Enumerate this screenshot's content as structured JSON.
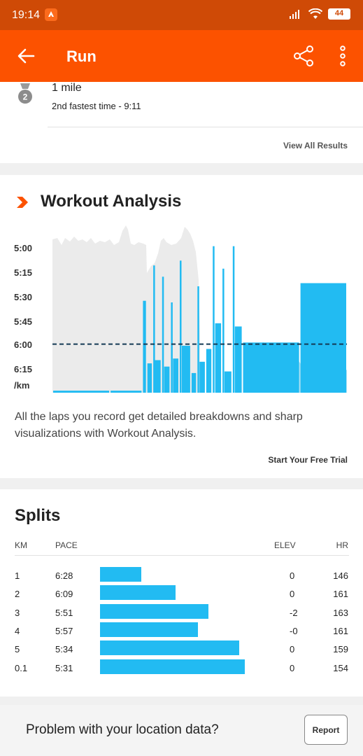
{
  "status_bar": {
    "time": "19:14",
    "battery": "44"
  },
  "app_bar": {
    "title": "Run",
    "back_icon": "back-arrow-icon",
    "share_icon": "share-icon",
    "more_icon": "more-vertical-icon"
  },
  "achievement": {
    "title": "1 mile",
    "subtitle": "2nd fastest time - 9:11",
    "medal_rank": "2",
    "view_all_label": "View All Results"
  },
  "workout_analysis": {
    "title": "Workout Analysis",
    "description": "All the laps you record get detailed breakdowns and sharp visualizations with Workout Analysis.",
    "trial_label": "Start Your Free Trial",
    "accent": "#fc5200",
    "bar_color": "#22bbf2",
    "y_tick_labels": [
      "5:00",
      "5:15",
      "5:30",
      "5:45",
      "6:00",
      "6:15",
      "/km"
    ]
  },
  "chart_data": {
    "type": "bar",
    "title": "",
    "ylabel": "/km",
    "y_ticks": [
      "5:00",
      "5:15",
      "5:30",
      "5:45",
      "6:00",
      "6:15"
    ],
    "average_pace_line": "6:00",
    "laps": [
      {
        "start": 0.0,
        "end": 0.195,
        "pace_sec": 389
      },
      {
        "start": 0.195,
        "end": 0.305,
        "pace_sec": 389
      },
      {
        "start": 0.305,
        "end": 0.32,
        "pace_sec": 333
      },
      {
        "start": 0.32,
        "end": 0.34,
        "pace_sec": 372
      },
      {
        "start": 0.34,
        "end": 0.345,
        "pace_sec": 311
      },
      {
        "start": 0.345,
        "end": 0.37,
        "pace_sec": 370
      },
      {
        "start": 0.37,
        "end": 0.377,
        "pace_sec": 318
      },
      {
        "start": 0.377,
        "end": 0.4,
        "pace_sec": 374
      },
      {
        "start": 0.4,
        "end": 0.407,
        "pace_sec": 334
      },
      {
        "start": 0.407,
        "end": 0.43,
        "pace_sec": 369
      },
      {
        "start": 0.43,
        "end": 0.437,
        "pace_sec": 308
      },
      {
        "start": 0.437,
        "end": 0.47,
        "pace_sec": 361
      },
      {
        "start": 0.47,
        "end": 0.49,
        "pace_sec": 378
      },
      {
        "start": 0.49,
        "end": 0.497,
        "pace_sec": 324
      },
      {
        "start": 0.497,
        "end": 0.52,
        "pace_sec": 371
      },
      {
        "start": 0.52,
        "end": 0.542,
        "pace_sec": 363
      },
      {
        "start": 0.542,
        "end": 0.55,
        "pace_sec": 299
      },
      {
        "start": 0.55,
        "end": 0.575,
        "pace_sec": 347
      },
      {
        "start": 0.575,
        "end": 0.582,
        "pace_sec": 313
      },
      {
        "start": 0.582,
        "end": 0.61,
        "pace_sec": 377
      },
      {
        "start": 0.61,
        "end": 0.617,
        "pace_sec": 299
      },
      {
        "start": 0.617,
        "end": 0.645,
        "pace_sec": 349
      },
      {
        "start": 0.645,
        "end": 0.84,
        "pace_sec": 359
      },
      {
        "start": 0.84,
        "end": 1.0,
        "pace_sec": 322
      }
    ]
  },
  "splits": {
    "title": "Splits",
    "columns": {
      "km": "KM",
      "pace": "PACE",
      "elev": "ELEV",
      "hr": "HR"
    },
    "rows": [
      {
        "km": "1",
        "pace": "6:28",
        "pace_sec": 388,
        "elev": "0",
        "hr": "146"
      },
      {
        "km": "2",
        "pace": "6:09",
        "pace_sec": 369,
        "elev": "0",
        "hr": "161"
      },
      {
        "km": "3",
        "pace": "5:51",
        "pace_sec": 351,
        "elev": "-2",
        "hr": "163"
      },
      {
        "km": "4",
        "pace": "5:57",
        "pace_sec": 357,
        "elev": "-0",
        "hr": "161"
      },
      {
        "km": "5",
        "pace": "5:34",
        "pace_sec": 334,
        "elev": "0",
        "hr": "159"
      },
      {
        "km": "0.1",
        "pace": "5:31",
        "pace_sec": 331,
        "elev": "0",
        "hr": "154"
      }
    ]
  },
  "footer": {
    "question": "Problem with your location data?",
    "report_label": "Report"
  }
}
